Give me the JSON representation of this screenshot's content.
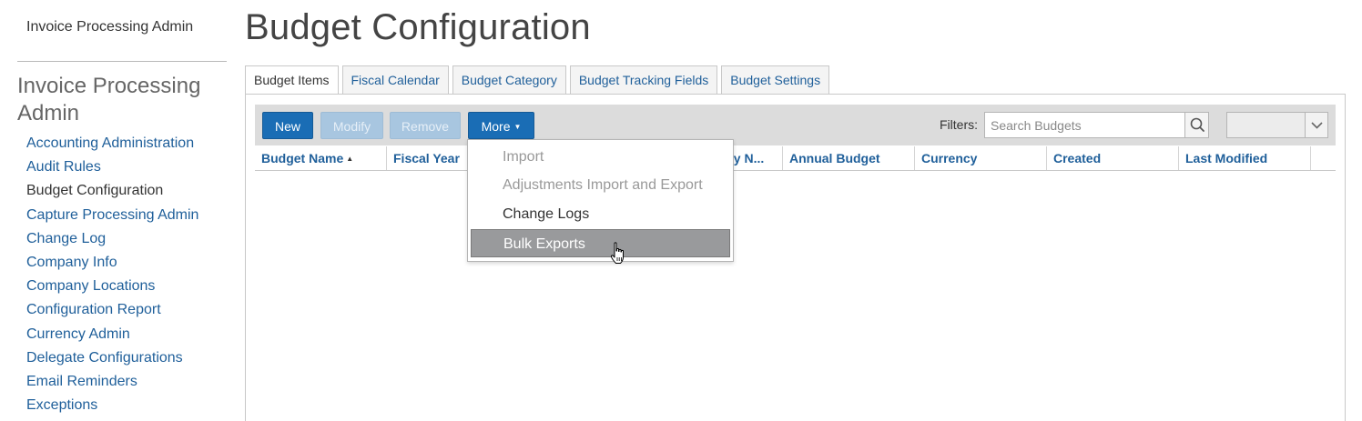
{
  "sidebar": {
    "top_link": "Invoice Processing Admin",
    "heading": "Invoice Processing Admin",
    "items": [
      {
        "label": "Accounting Administration"
      },
      {
        "label": "Audit Rules"
      },
      {
        "label": "Budget Configuration",
        "active": true
      },
      {
        "label": "Capture Processing Admin"
      },
      {
        "label": "Change Log"
      },
      {
        "label": "Company Info"
      },
      {
        "label": "Company Locations"
      },
      {
        "label": "Configuration Report"
      },
      {
        "label": "Currency Admin"
      },
      {
        "label": "Delegate Configurations"
      },
      {
        "label": "Email Reminders"
      },
      {
        "label": "Exceptions"
      }
    ]
  },
  "page": {
    "title": "Budget Configuration"
  },
  "tabs": [
    {
      "label": "Budget Items",
      "active": true
    },
    {
      "label": "Fiscal Calendar"
    },
    {
      "label": "Budget Category"
    },
    {
      "label": "Budget Tracking Fields"
    },
    {
      "label": "Budget Settings"
    }
  ],
  "toolbar": {
    "new_label": "New",
    "modify_label": "Modify",
    "remove_label": "Remove",
    "more_label": "More",
    "filters_label": "Filters:",
    "search_placeholder": "Search Budgets",
    "search_icon": "magnifier-icon",
    "select_icon": "chevron-down-icon"
  },
  "grid": {
    "columns": [
      {
        "label": "Budget Name",
        "sorted": "asc"
      },
      {
        "label": "Fiscal Year"
      },
      {
        "label": ""
      },
      {
        "label": "ay N..."
      },
      {
        "label": "Annual Budget"
      },
      {
        "label": "Currency"
      },
      {
        "label": "Created"
      },
      {
        "label": "Last Modified"
      }
    ],
    "rows": []
  },
  "more_menu": {
    "items": [
      {
        "label": "Import",
        "disabled": true
      },
      {
        "label": "Adjustments Import and Export",
        "disabled": true
      },
      {
        "label": "Change Logs"
      },
      {
        "label": "Bulk Exports",
        "hover": true
      }
    ]
  },
  "colors": {
    "link": "#1f5f9a",
    "primary_button": "#1a6db5",
    "disabled_button": "#a8c6e0",
    "toolbar_bg": "#dcdcdc",
    "menu_hover": "#999a9c"
  }
}
